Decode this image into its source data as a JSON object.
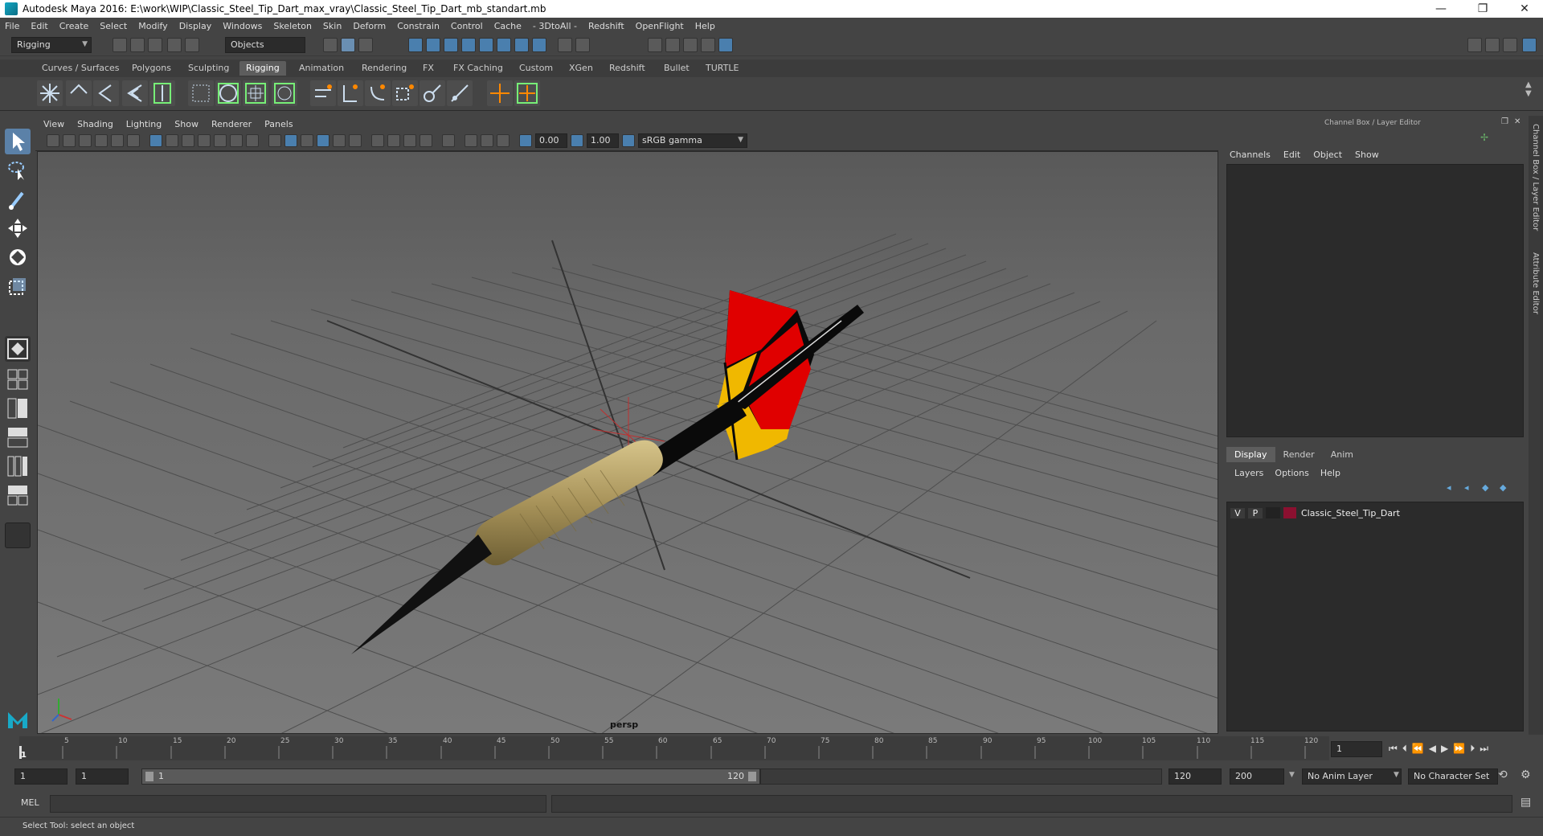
{
  "titlebar": {
    "title": "Autodesk Maya 2016: E:\\work\\WIP\\Classic_Steel_Tip_Dart_max_vray\\Classic_Steel_Tip_Dart_mb_standart.mb",
    "minimize": "—",
    "restore": "❐",
    "close": "✕"
  },
  "menu": [
    "File",
    "Edit",
    "Create",
    "Select",
    "Modify",
    "Display",
    "Windows",
    "Skeleton",
    "Skin",
    "Deform",
    "Constrain",
    "Control",
    "Cache",
    "- 3DtoAll -",
    "Redshift",
    "OpenFlight",
    "Help"
  ],
  "statusline": {
    "menuset": "Rigging",
    "selectmode": "Objects"
  },
  "shelf_tabs": [
    "Curves / Surfaces",
    "Polygons",
    "Sculpting",
    "Rigging",
    "Animation",
    "Rendering",
    "FX",
    "FX Caching",
    "Custom",
    "XGen",
    "Redshift",
    "Bullet",
    "TURTLE"
  ],
  "viewport": {
    "menu": [
      "View",
      "Shading",
      "Lighting",
      "Show",
      "Renderer",
      "Panels"
    ],
    "exposure": "0.00",
    "gamma": "1.00",
    "colorspace": "sRGB gamma",
    "camera": "persp"
  },
  "channelbox": {
    "title": "Channel Box / Layer Editor",
    "menu": [
      "Channels",
      "Edit",
      "Object",
      "Show"
    ]
  },
  "layereditor": {
    "tabs": [
      "Display",
      "Render",
      "Anim"
    ],
    "menu": [
      "Layers",
      "Options",
      "Help"
    ],
    "layers": [
      {
        "v": "V",
        "p": "P",
        "name": "Classic_Steel_Tip_Dart",
        "color": "#8b1030"
      }
    ]
  },
  "sidebar": {
    "tab1": "Channel Box / Layer Editor",
    "tab2": "Attribute Editor"
  },
  "timeline": {
    "ticks": [
      "5",
      "10",
      "15",
      "20",
      "25",
      "30",
      "35",
      "40",
      "45",
      "50",
      "55",
      "60",
      "65",
      "70",
      "75",
      "80",
      "85",
      "90",
      "95",
      "100",
      "105",
      "110",
      "115",
      "120"
    ],
    "start_marker": "1",
    "current_frame": "1"
  },
  "range": {
    "start": "1",
    "playback_start": "1",
    "slider_start": "1",
    "slider_end": "120",
    "playback_end": "120",
    "end": "200",
    "anim_layer": "No Anim Layer",
    "character_set": "No Character Set"
  },
  "cmdline": {
    "label": "MEL"
  },
  "helpline": {
    "text": "Select Tool: select an object"
  },
  "colors": {
    "accent": "#5b81a8",
    "active_tab": "#5d5d5d",
    "dart_red": "#e00000",
    "dart_yellow": "#f0b800",
    "dart_black": "#0a0a0a",
    "barrel": "#b8a46a"
  }
}
